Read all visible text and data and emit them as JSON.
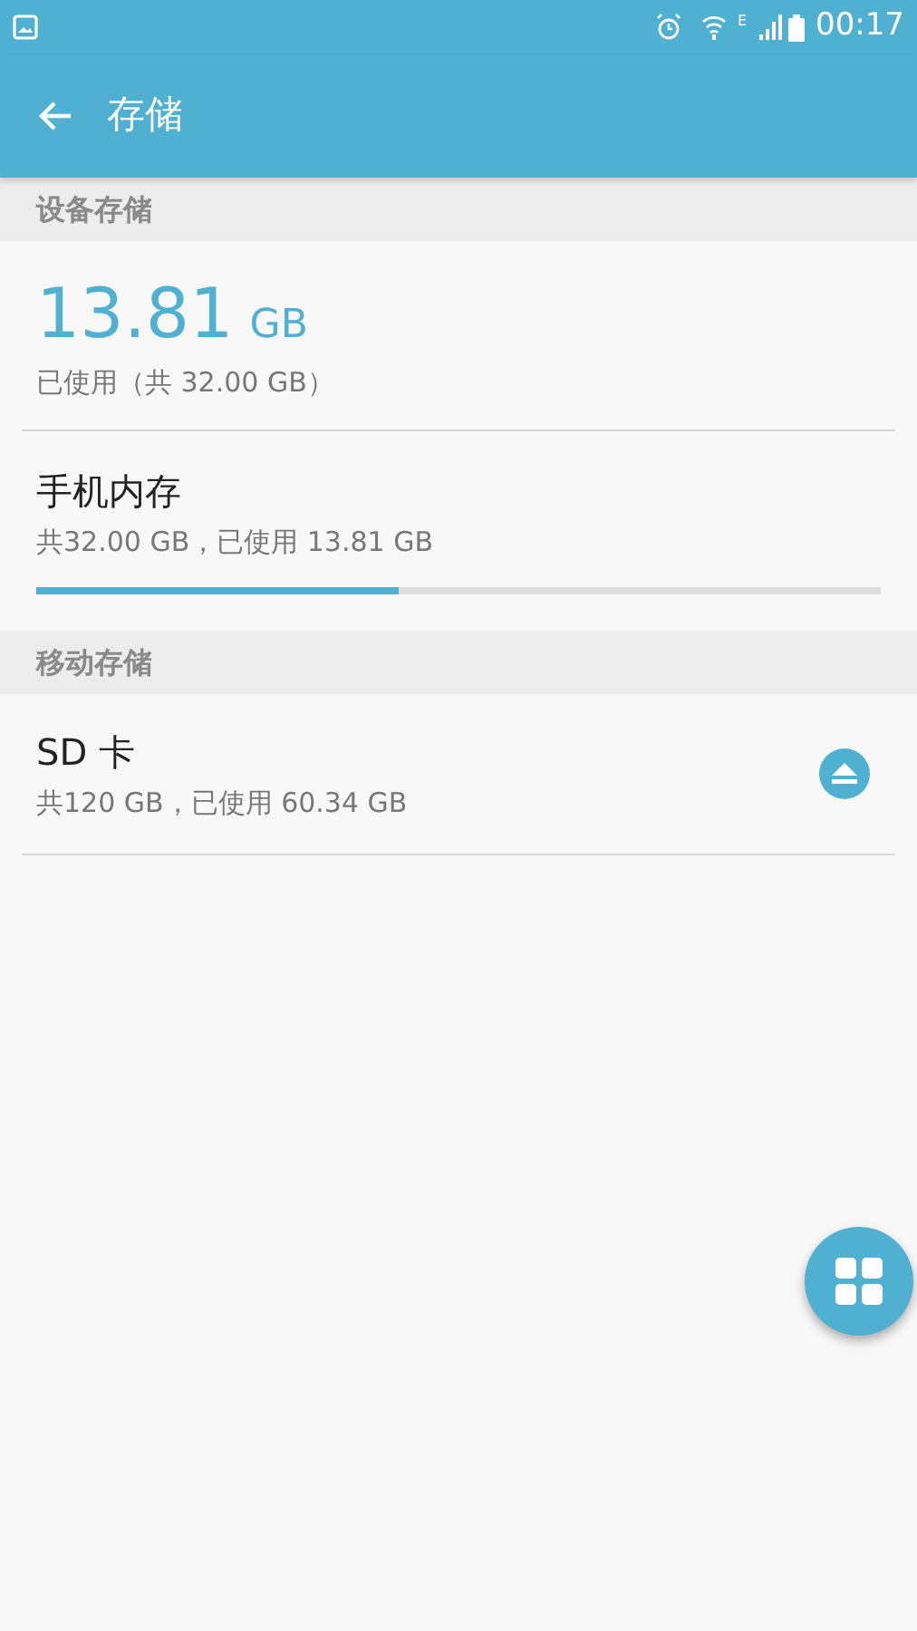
{
  "status_bar": {
    "network": "E",
    "time": "00:17"
  },
  "app_bar": {
    "title": "存储"
  },
  "sections": [
    {
      "header": "设备存储",
      "summary": {
        "used": "13.81",
        "unit": "GB",
        "caption": "已使用（共 32.00 GB）"
      },
      "items": [
        {
          "kind": "bar",
          "title": "手机内存",
          "detail": "共32.00 GB，已使用 13.81 GB",
          "level": 0.43
        }
      ]
    },
    {
      "header": "移动存储",
      "items": [
        {
          "kind": "eject",
          "title": "SD 卡",
          "detail": "共120 GB，已使用 60.34 GB"
        }
      ]
    }
  ]
}
